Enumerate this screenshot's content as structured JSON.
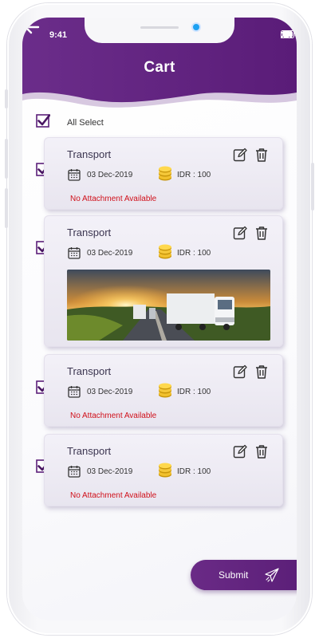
{
  "status_bar": {
    "time": "9:41"
  },
  "header": {
    "title": "Cart"
  },
  "select_all": {
    "label": "All Select",
    "checked": true
  },
  "cart_items": [
    {
      "title": "Transport",
      "date": "03 Dec-2019",
      "amount": "IDR : 100",
      "attachment": "No Attachment Available",
      "checked": true,
      "has_image": false
    },
    {
      "title": "Transport",
      "date": "03 Dec-2019",
      "amount": "IDR : 100",
      "attachment": "",
      "checked": true,
      "has_image": true
    },
    {
      "title": "Transport",
      "date": "03 Dec-2019",
      "amount": "IDR : 100",
      "attachment": "No Attachment Available",
      "checked": true,
      "has_image": false
    },
    {
      "title": "Transport",
      "date": "03 Dec-2019",
      "amount": "IDR : 100",
      "attachment": "No Attachment Available",
      "checked": true,
      "has_image": false
    }
  ],
  "submit": {
    "label": "Submit"
  },
  "icons": {
    "back": "back-arrow-icon",
    "edit": "edit-icon",
    "delete": "trash-icon",
    "date": "calendar-icon",
    "amount": "coin-stack-icon",
    "submit": "paper-plane-icon"
  },
  "colors": {
    "brand": "#5c1f7a",
    "brand_light": "#7a3a95",
    "error_text": "#d0101a",
    "card_bg": "#eeebf4"
  }
}
